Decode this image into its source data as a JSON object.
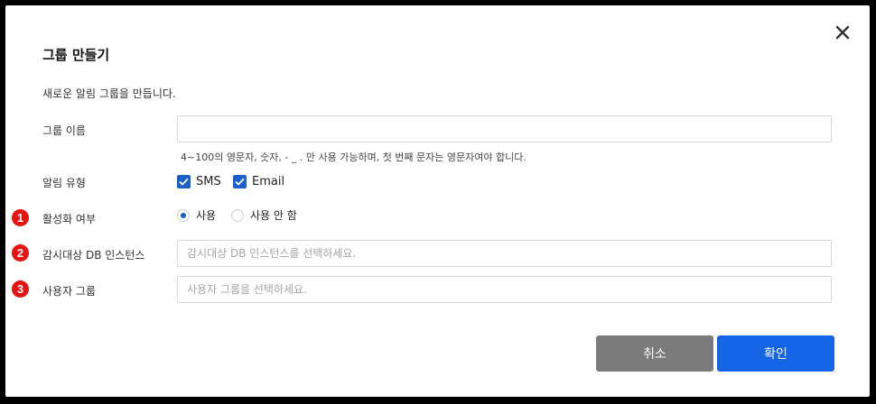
{
  "dialog": {
    "title": "그룹 만들기",
    "description": "새로운 알림 그룹을 만듭니다."
  },
  "group_name": {
    "label": "그룹 이름",
    "value": "",
    "placeholder": "",
    "hint": "4~100의 영문자, 숫자, - _ . 만 사용 가능하며, 첫 번째 문자는 영문자여야 합니다."
  },
  "alert_type": {
    "label": "알림 유형",
    "options": [
      {
        "label": "SMS",
        "checked": true
      },
      {
        "label": "Email",
        "checked": true
      }
    ]
  },
  "activation": {
    "marker": "1",
    "label": "활성화 여부",
    "options": [
      {
        "label": "사용",
        "selected": true
      },
      {
        "label": "사용 안 함",
        "selected": false
      }
    ]
  },
  "db_instance": {
    "marker": "2",
    "label": "감시대상 DB 인스턴스",
    "value": "",
    "placeholder": "감시대상 DB 인스턴스를 선택하세요."
  },
  "user_group": {
    "marker": "3",
    "label": "사용자 그룹",
    "value": "",
    "placeholder": "사용자 그룹을 선택하세요."
  },
  "buttons": {
    "cancel": "취소",
    "confirm": "확인"
  },
  "icons": {
    "close": "close-icon",
    "check": "checkmark-icon"
  },
  "colors": {
    "primary": "#1565e6",
    "checkbox": "#1a60c8",
    "cancel": "#7b7b7b",
    "marker": "#e8130f"
  }
}
